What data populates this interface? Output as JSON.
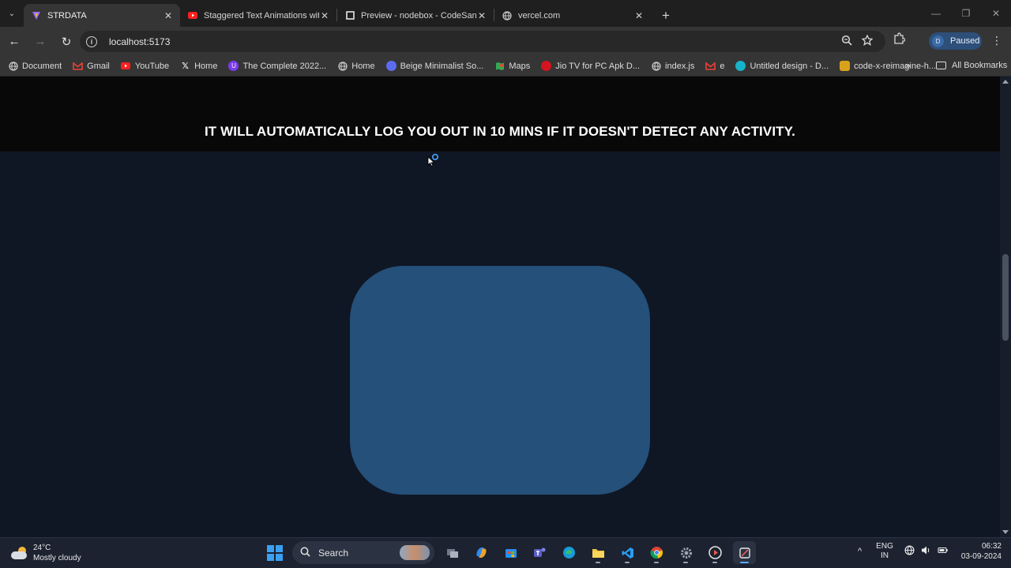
{
  "browser": {
    "tabs": [
      {
        "title": "STRDATA",
        "active": true,
        "favicon": "vite-icon"
      },
      {
        "title": "Staggered Text Animations with",
        "active": false,
        "favicon": "youtube-icon"
      },
      {
        "title": "Preview - nodebox - CodeSand",
        "active": false,
        "favicon": "codesandbox-icon"
      },
      {
        "title": "vercel.com",
        "active": false,
        "favicon": "globe-icon"
      }
    ],
    "url": "localhost:5173",
    "profile_initial": "D",
    "profile_status": "Paused",
    "bookmarks": [
      {
        "label": "Document",
        "icon": "globe-icon"
      },
      {
        "label": "Gmail",
        "icon": "gmail-icon"
      },
      {
        "label": "YouTube",
        "icon": "youtube-icon"
      },
      {
        "label": "Home",
        "icon": "x-icon"
      },
      {
        "label": "The Complete 2022...",
        "icon": "udemy-icon"
      },
      {
        "label": "Home",
        "icon": "globe-icon"
      },
      {
        "label": "Beige Minimalist So...",
        "icon": "canva-icon"
      },
      {
        "label": "Maps",
        "icon": "maps-icon"
      },
      {
        "label": "Jio TV for PC Apk D...",
        "icon": "jio-icon"
      },
      {
        "label": "index.js",
        "icon": "globe-icon"
      },
      {
        "label": "e",
        "icon": "gmail-icon"
      },
      {
        "label": "Untitled design - D...",
        "icon": "canva-icon"
      },
      {
        "label": "code-x-reimagine-h...",
        "icon": "code-icon"
      }
    ],
    "all_bookmarks": "All Bookmarks"
  },
  "page": {
    "banner_text": "IT WILL AUTOMATICALLY LOG YOU OUT IN 10 MINS IF IT DOESN'T DETECT ANY ACTIVITY."
  },
  "taskbar": {
    "weather_temp": "24°C",
    "weather_desc": "Mostly cloudy",
    "search_label": "Search",
    "lang_top": "ENG",
    "lang_bottom": "IN",
    "time": "06:32",
    "date": "03-09-2024"
  },
  "colors": {
    "page_bg": "#0f1624",
    "banner_bg": "#080808",
    "card": "#245079",
    "profile_chip": "#2d4f79"
  }
}
